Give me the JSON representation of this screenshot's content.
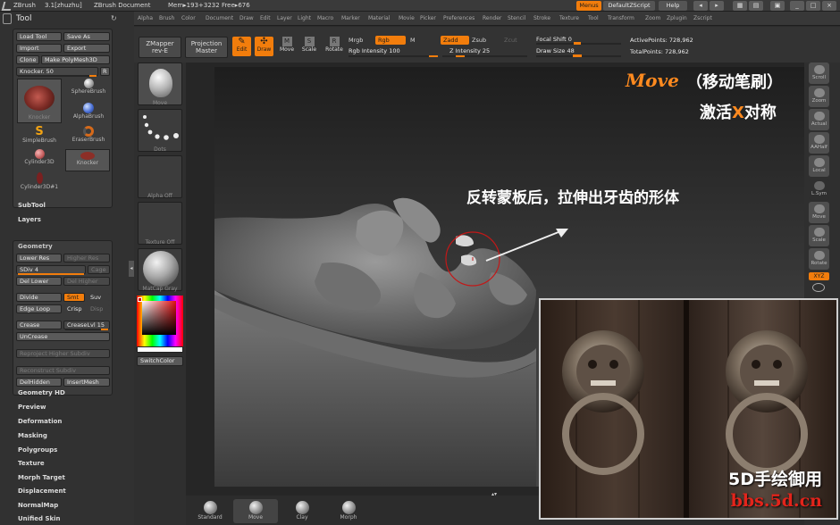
{
  "titlebar": {
    "app": "ZBrush",
    "version": "3.1[zhuzhu]",
    "document": "ZBrush Document",
    "mem": "Mem▸193+3232  Free▸676",
    "menus_btn": "Menus",
    "script_btn": "DefaultZScript",
    "help_btn": "Help"
  },
  "menubar": [
    "Alpha",
    "Brush",
    "Color",
    "Document",
    "Draw",
    "Edit",
    "Layer",
    "Light",
    "Macro",
    "Marker",
    "Material",
    "Movie",
    "Picker",
    "Preferences",
    "Render",
    "Stencil",
    "Stroke",
    "Texture",
    "Tool",
    "Transform",
    "Zoom",
    "Zplugin",
    "Zscript"
  ],
  "tool": {
    "title": "Tool",
    "load": "Load Tool",
    "save_as": "Save As",
    "import": "Import",
    "export": "Export",
    "clone": "Clone",
    "make_polymesh": "Make PolyMesh3D",
    "knocker": "Knocker. 50",
    "r_btn": "R",
    "brushes": [
      "Knocker",
      "SphereBrush",
      "AlphaBrush",
      "SimpleBrush",
      "EraserBrush",
      "Cylinder3D",
      "Knocker",
      "Cylinder3D#1"
    ]
  },
  "sections": {
    "subtool": "SubTool",
    "layers": "Layers",
    "geometry": "Geometry",
    "geometry_hd": "Geometry HD",
    "preview": "Preview",
    "deformation": "Deformation",
    "masking": "Masking",
    "polygroups": "Polygroups",
    "texture": "Texture",
    "morph_target": "Morph Target",
    "displacement": "Displacement",
    "normalmap": "NormalMap",
    "unified_skin": "Unified Skin"
  },
  "geometry": {
    "lower_res": "Lower Res",
    "higher_res": "Higher Res",
    "sdiv": "SDiv 4",
    "cage": "Cage",
    "del_lower": "Del Lower",
    "del_higher": "Del Higher",
    "divide": "Divide",
    "smt": "Smt",
    "suv": "Suv",
    "edge_loop": "Edge Loop",
    "crisp": "Crisp",
    "disp": "Disp",
    "crease": "Crease",
    "creaselvl": "CreaseLvl 15",
    "uncrease": "UnCrease",
    "reproject": "Reproject Higher Subdiv",
    "reconstruct": "Reconstruct Subdiv",
    "delhidden": "DelHidden",
    "insertmesh": "InsertMesh"
  },
  "shelf": {
    "zmapper": "ZMapper",
    "zmapper_sub": "rev-E",
    "projection": "Projection",
    "projection_sub": "Master",
    "edit": "Edit",
    "draw": "Draw",
    "move": "Move",
    "scale": "Scale",
    "rotate": "Rotate",
    "mrgb": "Mrgb",
    "rgb": "Rgb",
    "m": "M",
    "rgb_intensity": "Rgb Intensity 100",
    "zadd": "Zadd",
    "zsub": "Zsub",
    "zcut": "Zcut",
    "z_intensity": "Z Intensity 25",
    "focal_shift": "Focal Shift 0",
    "draw_size": "Draw Size 48",
    "active_points": "ActivePoints: 728,962",
    "total_points": "TotalPoints: 728,962"
  },
  "leftshelf": {
    "move": "Move",
    "dots": "Dots",
    "alpha_off": "Alpha Off",
    "texture_off": "Texture Off",
    "matcap": "MatCap Gray",
    "switchcolor": "SwitchColor"
  },
  "rightshelf": [
    "Scroll",
    "Zoom",
    "Actual",
    "AAHalf",
    "Local",
    "L.Sym",
    "Move",
    "Scale",
    "Rotate"
  ],
  "xyz_label": "XYZ",
  "bottomshelf": [
    "Standard",
    "Move",
    "Clay",
    "Morph"
  ],
  "annotations": {
    "move_title": "Move",
    "move_cn": "（移动笔刷）",
    "activate": "激活X对称",
    "x_letter": "X",
    "activate_pre": "激活",
    "activate_post": "对称",
    "main_note": "反转蒙板后，拉伸出牙齿的形体",
    "watermark1": "5D手绘御用",
    "watermark2": "bbs.5d.cn"
  },
  "colors": {
    "accent": "#f27d0c",
    "annot_orange": "#ff8a1f",
    "watermark_red": "#e3241b"
  }
}
